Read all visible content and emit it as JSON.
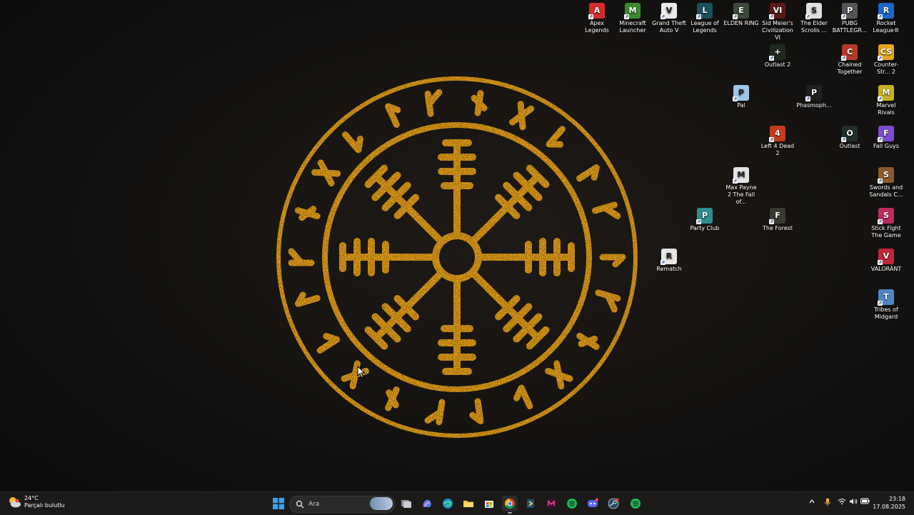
{
  "desktop_icons": [
    {
      "label": "Apex Legends",
      "bg": "#d42b2b",
      "glyph": "A"
    },
    {
      "label": "Minecraft Launcher",
      "bg": "#3b8a2e",
      "glyph": "M"
    },
    {
      "label": "Grand Theft Auto V",
      "bg": "#e9e9e9",
      "glyph": "V"
    },
    {
      "label": "League of Legends",
      "bg": "#1d4f5c",
      "glyph": "L"
    },
    {
      "label": "ELDEN RING",
      "bg": "#3b4a3a",
      "glyph": "E"
    },
    {
      "label": "Sid Meier's Civilization VI",
      "bg": "#5a1a1a",
      "glyph": "VI"
    },
    {
      "label": "The Elder Scrolls ...",
      "bg": "#e0e0e0",
      "glyph": "S"
    },
    {
      "label": "PUBG BATTLEGR...",
      "bg": "#555555",
      "glyph": "P"
    },
    {
      "label": "Rocket League®",
      "bg": "#1b66c9",
      "glyph": "R"
    },
    {
      "label": "Outlast 2",
      "bg": "#1d2a1d",
      "glyph": "+"
    },
    {
      "label": "Chained Together",
      "bg": "#b63a2a",
      "glyph": "C"
    },
    {
      "label": "Counter-Str... 2",
      "bg": "#e8a515",
      "glyph": "CS"
    },
    {
      "label": "Pal",
      "bg": "#9ec7e6",
      "glyph": "P"
    },
    {
      "label": "Phasmoph...",
      "bg": "#202020",
      "glyph": "P"
    },
    {
      "label": "Marvel Rivals",
      "bg": "#c8b21e",
      "glyph": "M"
    },
    {
      "label": "Left 4 Dead 2",
      "bg": "#c73a1d",
      "glyph": "4"
    },
    {
      "label": "Outlast",
      "bg": "#1f2f2a",
      "glyph": "O"
    },
    {
      "label": "Fall Guys",
      "bg": "#7d4bd1",
      "glyph": "F"
    },
    {
      "label": "Max Payne 2 The Fall of...",
      "bg": "#e5e5e5",
      "glyph": "M"
    },
    {
      "label": "Swords and Sandals C...",
      "bg": "#8c5a2b",
      "glyph": "S"
    },
    {
      "label": "Party Club",
      "bg": "#2f8f8f",
      "glyph": "P"
    },
    {
      "label": "The Forest",
      "bg": "#3a3a30",
      "glyph": "F"
    },
    {
      "label": "Stick Fight The Game",
      "bg": "#c02b60",
      "glyph": "S"
    },
    {
      "label": "Rematch",
      "bg": "#e6e6e6",
      "glyph": "R"
    },
    {
      "label": "VALORANT",
      "bg": "#c2263b",
      "glyph": "V"
    },
    {
      "label": "Tribes of Midgard",
      "bg": "#4e86c4",
      "glyph": "T"
    }
  ],
  "taskbar": {
    "weather": {
      "temperature": "24°C",
      "condition": "Parçalı bulutlu"
    },
    "search_placeholder": "Ara",
    "clock": {
      "time": "23:18",
      "date": "17.08.2025"
    }
  },
  "colors": {
    "rune_gold": "#e8a017",
    "taskbar_bg": "#1b1a19"
  }
}
